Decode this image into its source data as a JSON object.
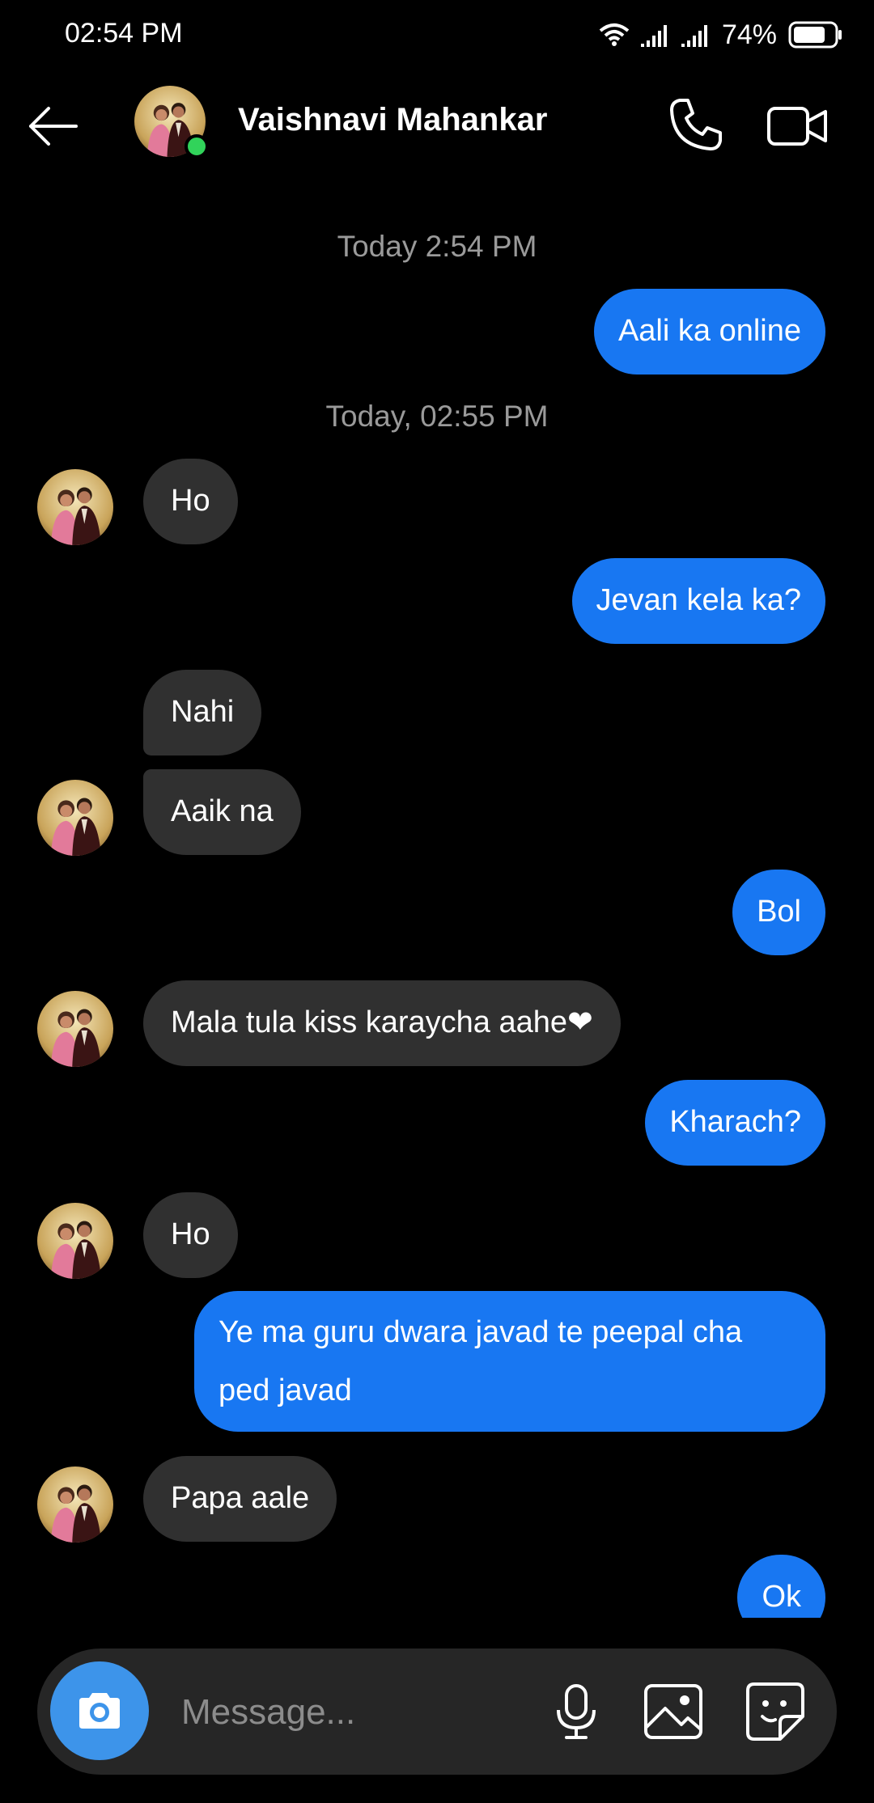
{
  "status_bar": {
    "time": "02:54 PM",
    "battery": "74%",
    "icons": [
      "wifi-icon",
      "signal-icon",
      "signal-icon",
      "battery-icon"
    ]
  },
  "header": {
    "contact_name": "Vaishnavi Mahankar",
    "online": true
  },
  "thread": {
    "timestamps": [
      "Today 2:54 PM",
      "Today, 02:55 PM"
    ],
    "messages": [
      {
        "dir": "out",
        "text": "Aali ka online"
      },
      {
        "dir": "in",
        "text": "Ho"
      },
      {
        "dir": "out",
        "text": "Jevan kela ka?"
      },
      {
        "dir": "in",
        "text": "Nahi"
      },
      {
        "dir": "in",
        "text": "Aaik na"
      },
      {
        "dir": "out",
        "text": "Bol"
      },
      {
        "dir": "in",
        "text": "Mala tula kiss karaycha aahe❤"
      },
      {
        "dir": "out",
        "text": "Kharach?"
      },
      {
        "dir": "in",
        "text": "Ho"
      },
      {
        "dir": "out",
        "text": "Ye ma guru dwara javad te peepal cha ped javad"
      },
      {
        "dir": "in",
        "text": "Papa aale"
      },
      {
        "dir": "out",
        "text": "Ok"
      }
    ]
  },
  "composer": {
    "placeholder": "Message..."
  },
  "colors": {
    "outgoing": "#1877f2",
    "incoming": "#303030",
    "online": "#31d35a",
    "camera": "#3d94ea"
  }
}
